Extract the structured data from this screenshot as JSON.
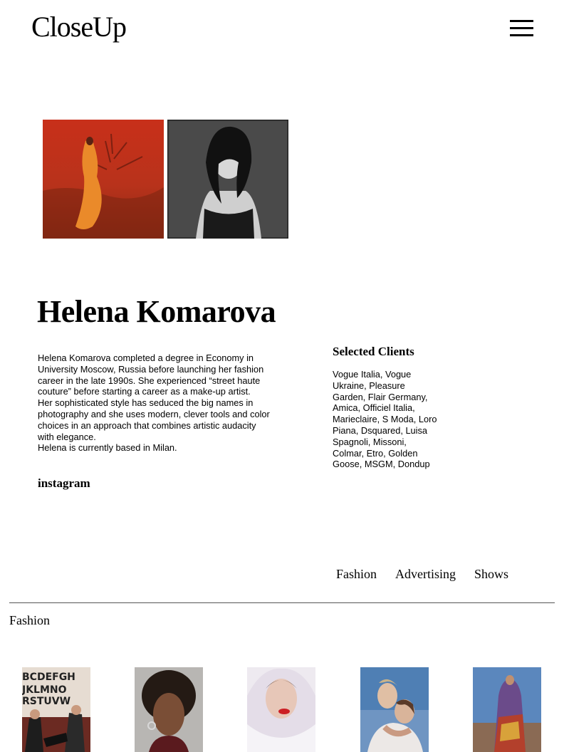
{
  "header": {
    "logo": "CloseUp",
    "menu_icon": "hamburger-menu-icon"
  },
  "profile": {
    "name": "Helena Komarova",
    "bio": [
      "Helena Komarova completed a degree in Economy in University Moscow, Russia before launching her fashion career in the late 1990s. She experienced “street haute couture” before starting a career as a make-up artist.",
      "Her sophisticated style has seduced the big names in photography and she uses modern, clever tools and color choices in an approach that combines artistic audacity with elegance.",
      "Helena is currently based in Milan."
    ],
    "instagram_label": "instagram"
  },
  "clients": {
    "heading": "Selected Clients",
    "text": "Vogue Italia, Vogue Ukraine, Pleasure Garden, Flair Germany, Amica, Officiel Italia, Marieclaire, S Moda, Loro Piana, Dsquared, Luisa Spagnoli, Missoni, Colmar, Etro, Golden Goose, MSGM, Dondup"
  },
  "tabs": [
    "Fashion",
    "Advertising",
    "Shows"
  ],
  "portfolio": {
    "section_title": "Fashion"
  },
  "colors": {
    "text": "#000000",
    "background": "#ffffff",
    "divider": "#555555"
  }
}
